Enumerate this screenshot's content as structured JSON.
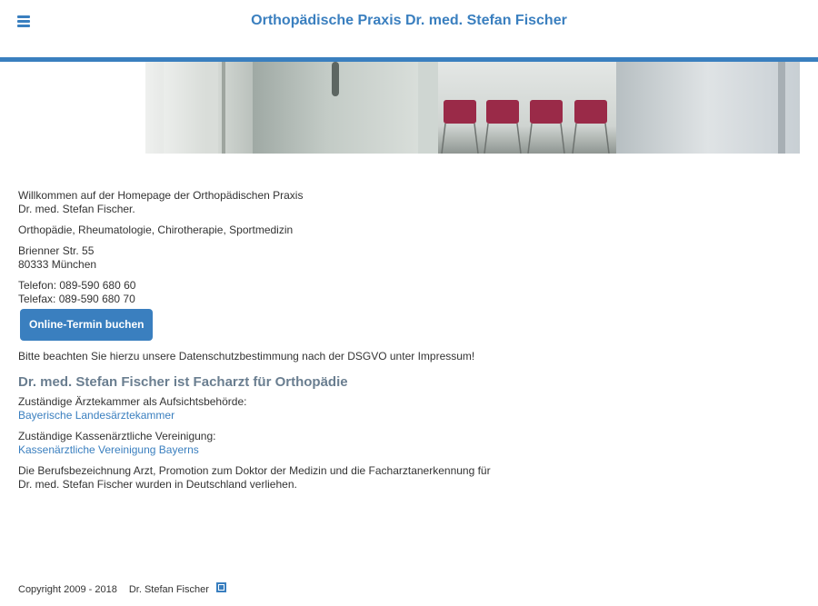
{
  "header": {
    "title": "Orthopädische Praxis Dr. med. Stefan Fischer",
    "menu_icon": "hamburger-menu-icon",
    "accent_color": "#3a7fbf"
  },
  "intro": {
    "welcome_line1": "Willkommen auf der Homepage der Orthopädischen Praxis",
    "welcome_line2": "Dr. med. Stefan Fischer.",
    "specialties": "Orthopädie, Rheumatologie, Chirotherapie, Sportmedizin",
    "street": "Brienner Str. 55",
    "city": "80333 München",
    "phone": "Telefon: 089-590 680 60",
    "fax": "Telefax: 089-590 680 70"
  },
  "booking": {
    "button_label": "Online-Termin buchen"
  },
  "privacy_notice": "Bitte beachten Sie hierzu unsere Datenschutzbestimmung nach der DSGVO unter Impressum!",
  "professional": {
    "heading": "Dr. med. Stefan Fischer ist Facharzt für Orthopädie",
    "chamber_label": "Zuständige Ärztekammer als Aufsichtsbehörde:",
    "chamber_link": "Bayerische Landesärztekammer",
    "kv_label": "Zuständige Kassenärztliche Vereinigung:",
    "kv_link": "Kassenärztliche Vereinigung Bayerns",
    "conferral_line1": "Die Berufsbezeichnung Arzt, Promotion zum Doktor der Medizin und die Facharztanerkennung für",
    "conferral_line2": "Dr. med. Stefan Fischer wurden in Deutschland verliehen."
  },
  "footer": {
    "copyright": "Copyright 2009 - 2018",
    "owner": "Dr. Stefan Fischer",
    "login_icon": "login-square-icon"
  }
}
